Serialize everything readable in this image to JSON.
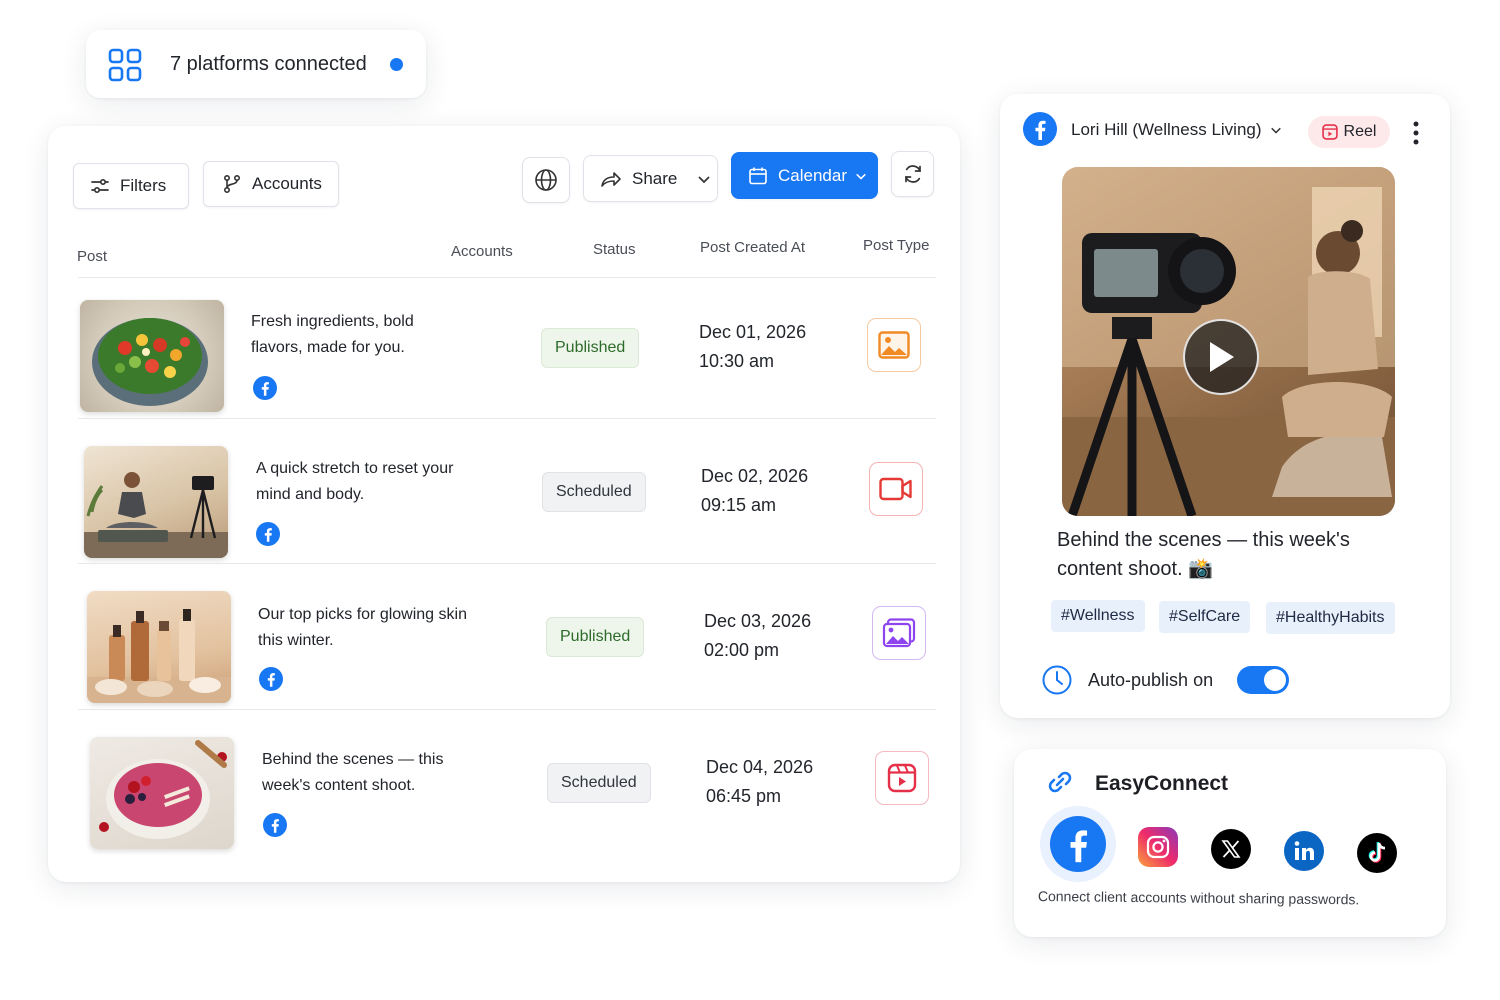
{
  "platforms_badge": {
    "text": "7 platforms connected"
  },
  "toolbar": {
    "filters_label": "Filters",
    "accounts_label": "Accounts",
    "share_label": "Share",
    "calendar_label": "Calendar"
  },
  "table": {
    "headers": {
      "post": "Post",
      "accounts": "Accounts",
      "status": "Status",
      "created": "Post Created At",
      "type": "Post Type"
    },
    "rows": [
      {
        "text": "Fresh ingredients, bold flavors, made for you.",
        "status": "Published",
        "date": "Dec 01, 2026",
        "time": "10:30 am",
        "post_type": "image"
      },
      {
        "text": "A quick stretch to reset your mind and body.",
        "status": "Scheduled",
        "date": "Dec 02, 2026",
        "time": "09:15 am",
        "post_type": "video"
      },
      {
        "text": "Our top picks for glowing skin this winter.",
        "status": "Published",
        "date": "Dec 03, 2026",
        "time": "02:00 pm",
        "post_type": "carousel"
      },
      {
        "text": "Behind the scenes — this week's content shoot.",
        "status": "Scheduled",
        "date": "Dec 04, 2026",
        "time": "06:45 pm",
        "post_type": "reel"
      }
    ]
  },
  "preview": {
    "account_name": "Lori Hill (Wellness Living)",
    "type_badge": "Reel",
    "caption": "Behind the scenes — this week's content shoot. 📸",
    "hashtags": [
      "#Wellness",
      "#SelfCare",
      "#HealthyHabits"
    ],
    "autopublish_label": "Auto-publish on",
    "autopublish_on": true
  },
  "easyconnect": {
    "title": "EasyConnect",
    "subtitle": "Connect client accounts without sharing passwords.",
    "platform_icons": [
      "facebook-icon",
      "instagram-icon",
      "x-icon",
      "linkedin-icon",
      "tiktok-icon"
    ]
  },
  "colors": {
    "accent": "#1877f2",
    "facebook": "#1877f2",
    "published_bg": "#eef6ec",
    "scheduled_bg": "#f1f2f4"
  }
}
